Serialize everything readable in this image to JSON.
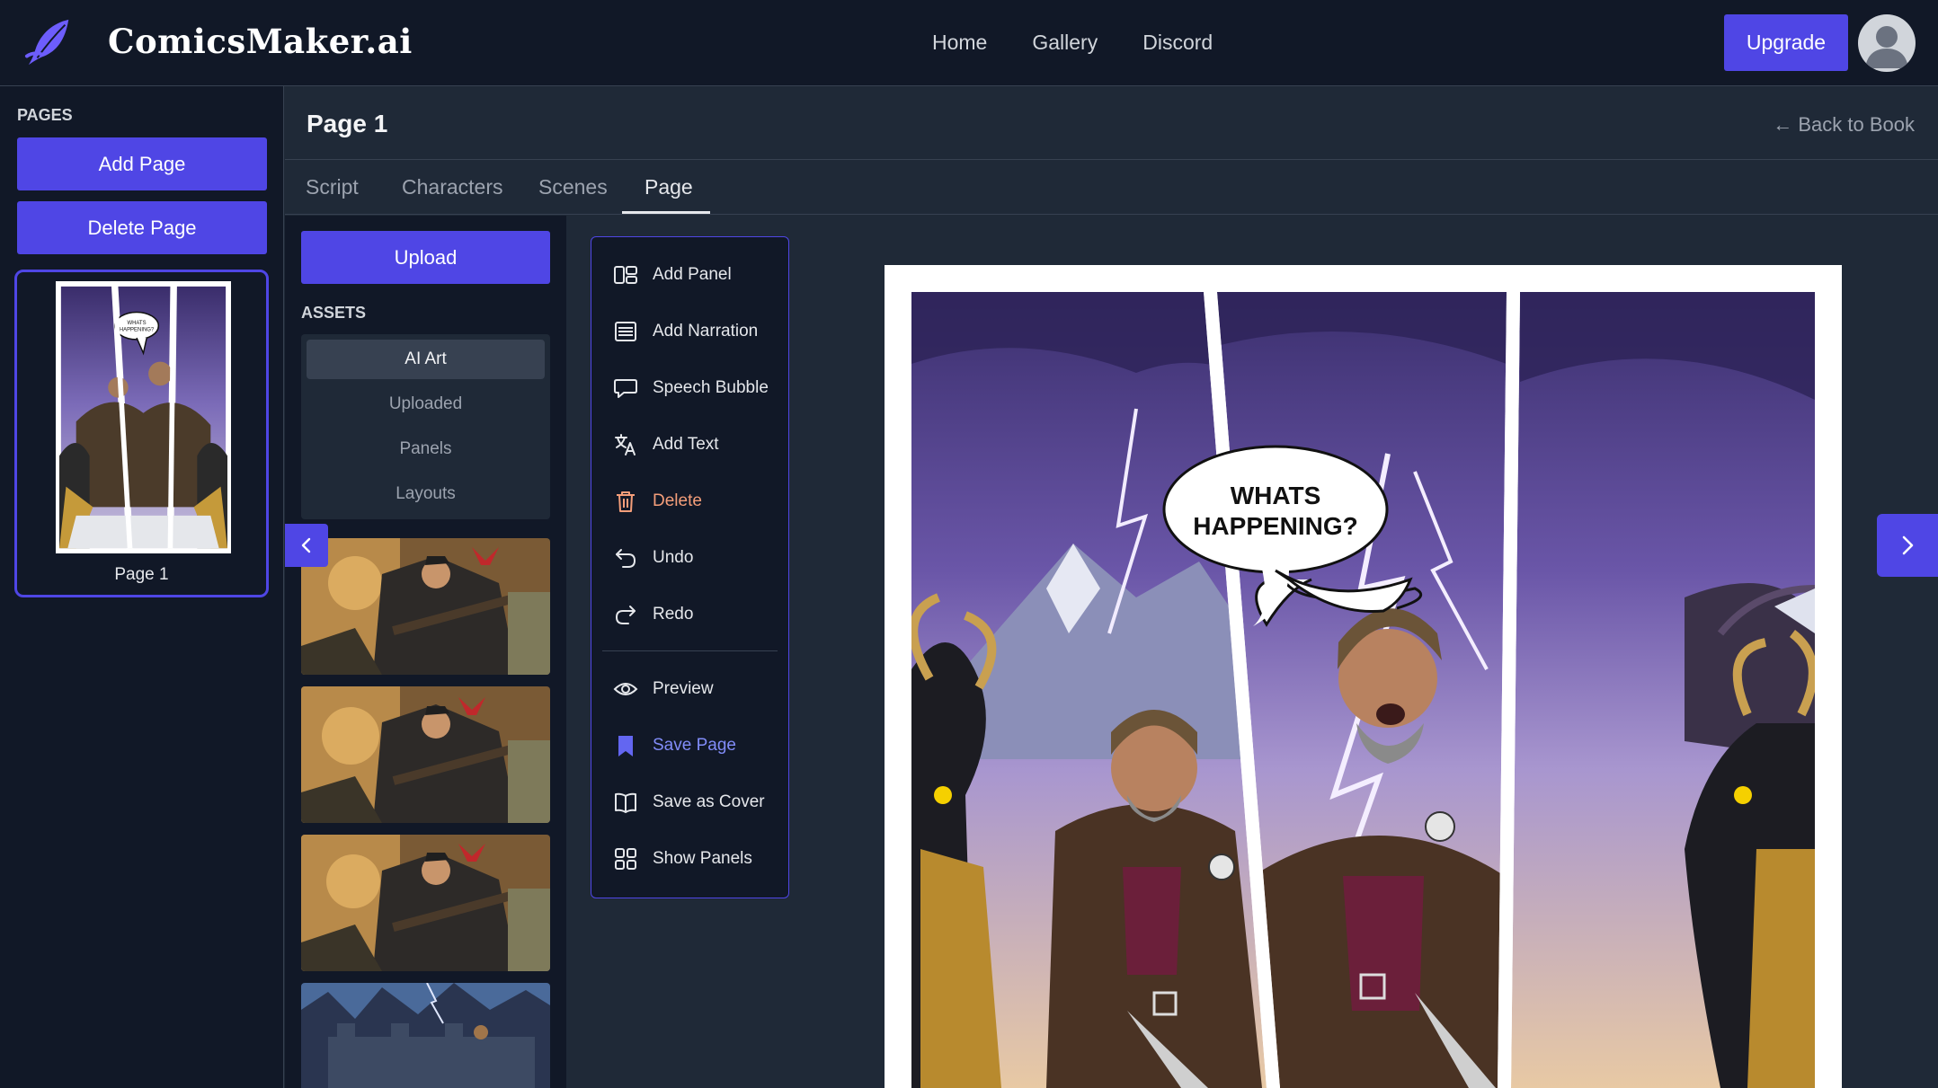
{
  "app": {
    "brand": "ComicsMaker.ai",
    "nav": [
      "Home",
      "Gallery",
      "Discord"
    ],
    "upgrade_label": "Upgrade"
  },
  "sidebar": {
    "section_label": "PAGES",
    "add_page_label": "Add Page",
    "delete_page_label": "Delete Page",
    "pages": [
      {
        "label": "Page 1",
        "thumb_bubble": "WHATS HAPPENING?"
      }
    ]
  },
  "header": {
    "title": "Page 1",
    "back_label": "← Back to Book"
  },
  "tabs": [
    {
      "label": "Script",
      "active": false
    },
    {
      "label": "Characters",
      "active": false
    },
    {
      "label": "Scenes",
      "active": false
    },
    {
      "label": "Page",
      "active": true
    }
  ],
  "assets": {
    "upload_label": "Upload",
    "section_label": "ASSETS",
    "filters": [
      {
        "label": "AI Art",
        "active": true
      },
      {
        "label": "Uploaded",
        "active": false
      },
      {
        "label": "Panels",
        "active": false
      },
      {
        "label": "Layouts",
        "active": false
      }
    ]
  },
  "tools": [
    {
      "label": "Add Panel",
      "icon": "add-panel-icon"
    },
    {
      "label": "Add Narration",
      "icon": "narration-icon"
    },
    {
      "label": "Speech Bubble",
      "icon": "speech-bubble-icon"
    },
    {
      "label": "Add Text",
      "icon": "translate-text-icon"
    },
    {
      "label": "Delete",
      "icon": "trash-icon"
    },
    {
      "label": "Undo",
      "icon": "undo-icon"
    },
    {
      "label": "Redo",
      "icon": "redo-icon"
    },
    {
      "label": "Preview",
      "icon": "eye-icon"
    },
    {
      "label": "Save Page",
      "icon": "bookmark-icon"
    },
    {
      "label": "Save as Cover",
      "icon": "book-icon"
    },
    {
      "label": "Show Panels",
      "icon": "grid-icon"
    }
  ],
  "canvas": {
    "speech_bubble_line1": "WHATS",
    "speech_bubble_line2": "HAPPENING?"
  },
  "colors": {
    "accent": "#4f46e5",
    "background": "#1f2937",
    "panel": "#111827",
    "danger": "#f59e7a",
    "accent_text": "#818cf8"
  }
}
